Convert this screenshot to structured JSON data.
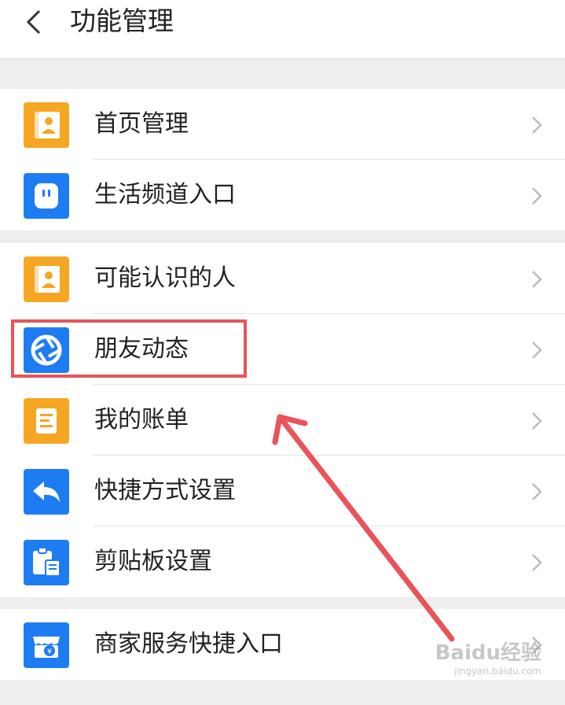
{
  "header": {
    "title": "功能管理"
  },
  "groups": [
    {
      "items": [
        {
          "label": "首页管理",
          "icon": "contact-card-icon",
          "color": "#f5a623"
        },
        {
          "label": "生活频道入口",
          "icon": "life-channel-icon",
          "color": "#1e7cf2"
        }
      ]
    },
    {
      "items": [
        {
          "label": "可能认识的人",
          "icon": "contact-card-icon",
          "color": "#f5a623"
        },
        {
          "label": "朋友动态",
          "icon": "shutter-icon",
          "color": "#1e7cf2"
        },
        {
          "label": "我的账单",
          "icon": "bill-icon",
          "color": "#f5a623"
        },
        {
          "label": "快捷方式设置",
          "icon": "reply-arrow-icon",
          "color": "#1e7cf2"
        },
        {
          "label": "剪贴板设置",
          "icon": "clipboard-icon",
          "color": "#1e7cf2"
        }
      ]
    },
    {
      "items": [
        {
          "label": "商家服务快捷入口",
          "icon": "store-icon",
          "color": "#1e7cf2"
        }
      ]
    }
  ],
  "annotation": {
    "color": "#e8545a"
  },
  "watermark": {
    "text": "Baidu经验",
    "subtext": "jingyan.baidu.com"
  }
}
